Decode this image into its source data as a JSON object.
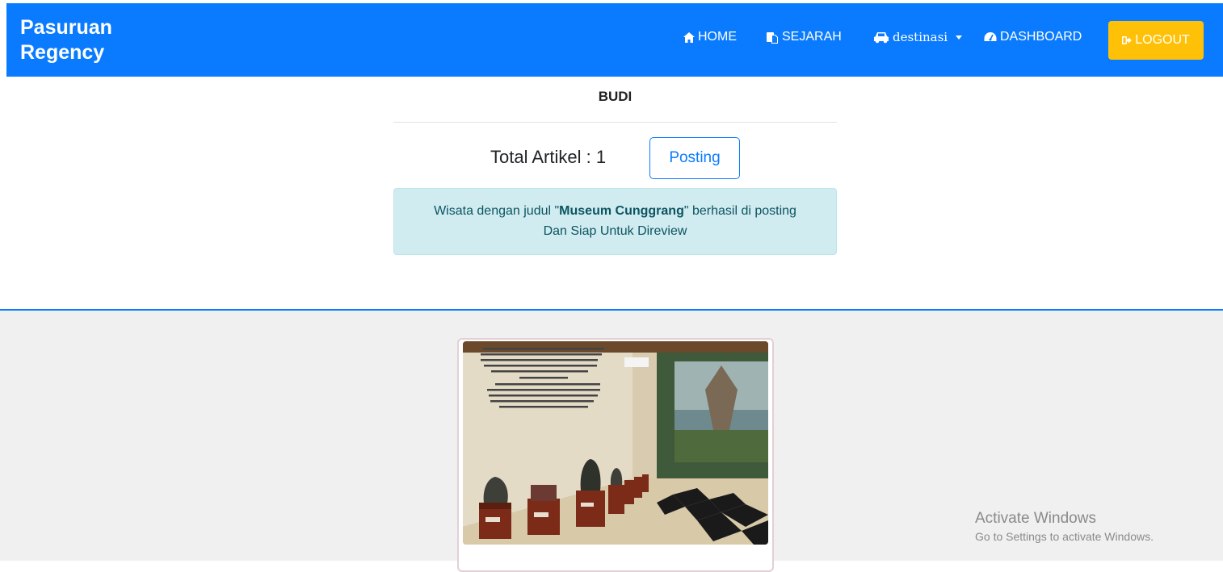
{
  "navbar": {
    "brand_line1": "Pasuruan",
    "brand_line2": "Regency",
    "items": [
      {
        "label": "HOME",
        "icon": "home-icon"
      },
      {
        "label": "SEJARAH",
        "icon": "copy-icon"
      },
      {
        "label": "destinasi",
        "icon": "car-icon"
      },
      {
        "label": "DASHBOARD",
        "icon": "dashboard-icon"
      }
    ],
    "logout_label": "LOGOUT",
    "colors": {
      "bg": "#0a7bff",
      "logout": "#ffc107"
    }
  },
  "profile": {
    "name": "BUDI",
    "total_label": "Total Artikel : 1",
    "posting_label": "Posting"
  },
  "alert": {
    "prefix": "Wisata dengan judul \"",
    "title": "Museum Cunggrang",
    "suffix": "\" berhasil di posting",
    "line2": "Dan Siap Untuk Direview"
  },
  "card": {
    "image_alt": "museum-interior-photo"
  },
  "watermark": {
    "title": "Activate Windows",
    "subtitle": "Go to Settings to activate Windows."
  }
}
